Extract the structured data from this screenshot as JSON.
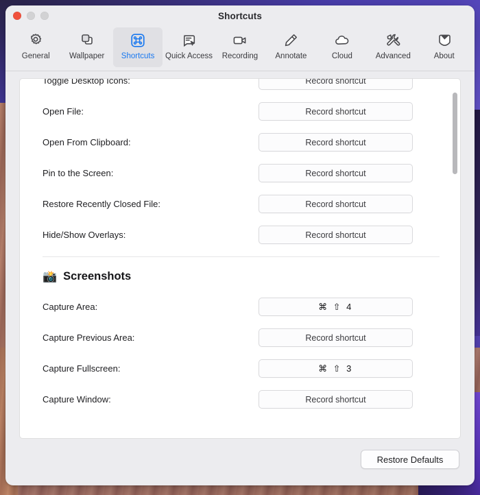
{
  "window": {
    "title": "Shortcuts",
    "traffic_lights": [
      {
        "name": "close",
        "color": "#f0503c"
      },
      {
        "name": "minimize",
        "color": "#d2d2d4"
      },
      {
        "name": "maximize",
        "color": "#d2d2d4"
      }
    ]
  },
  "toolbar": {
    "active_tab": "Shortcuts",
    "accent_color": "#1878f0",
    "tabs": [
      {
        "label": "General",
        "icon": "gear-icon",
        "active": false
      },
      {
        "label": "Wallpaper",
        "icon": "layers-icon",
        "active": false
      },
      {
        "label": "Shortcuts",
        "icon": "command-key-icon",
        "active": true
      },
      {
        "label": "Quick Access",
        "icon": "quick-access-icon",
        "active": false
      },
      {
        "label": "Recording",
        "icon": "video-camera-icon",
        "active": false
      },
      {
        "label": "Annotate",
        "icon": "pencil-icon",
        "active": false
      },
      {
        "label": "Cloud",
        "icon": "cloud-icon",
        "active": false
      },
      {
        "label": "Advanced",
        "icon": "tools-icon",
        "active": false
      },
      {
        "label": "About",
        "icon": "info-tag-icon",
        "active": false
      }
    ]
  },
  "content": {
    "record_placeholder": "Record shortcut",
    "top_rows": [
      {
        "label": "Toggle Desktop Icons:",
        "shortcut": "",
        "value": "Record shortcut"
      },
      {
        "label": "Open File:",
        "shortcut": "",
        "value": "Record shortcut"
      },
      {
        "label": "Open From Clipboard:",
        "shortcut": "",
        "value": "Record shortcut"
      },
      {
        "label": "Pin to the Screen:",
        "shortcut": "",
        "value": "Record shortcut"
      },
      {
        "label": "Restore Recently Closed File:",
        "shortcut": "",
        "value": "Record shortcut"
      },
      {
        "label": "Hide/Show Overlays:",
        "shortcut": "",
        "value": "Record shortcut"
      }
    ],
    "section": {
      "emoji": "📸",
      "icon": "camera-with-flash-icon",
      "title": "Screenshots"
    },
    "section_rows": [
      {
        "label": "Capture Area:",
        "shortcut": "⌘ ⇧ 4",
        "value": "⌘ ⇧ 4",
        "assigned": true
      },
      {
        "label": "Capture Previous Area:",
        "shortcut": "",
        "value": "Record shortcut",
        "assigned": false
      },
      {
        "label": "Capture Fullscreen:",
        "shortcut": "⌘ ⇧ 3",
        "value": "⌘ ⇧ 3",
        "assigned": true
      },
      {
        "label": "Capture Window:",
        "shortcut": "",
        "value": "Record shortcut",
        "assigned": false
      }
    ]
  },
  "footer": {
    "restore_defaults_label": "Restore Defaults"
  }
}
